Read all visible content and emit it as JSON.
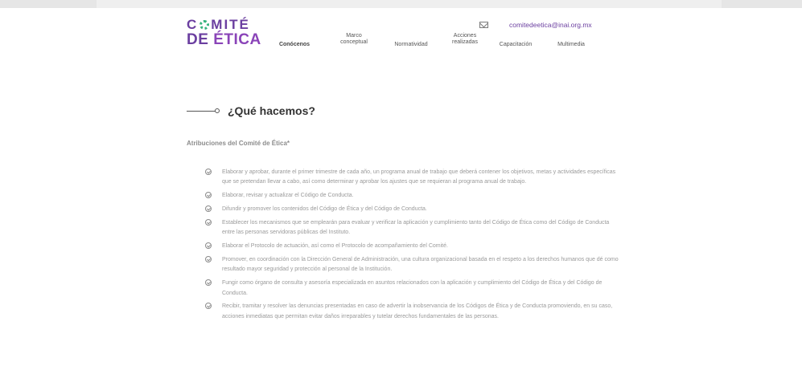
{
  "logo": {
    "line1_a": "C",
    "line1_b": "MITÉ",
    "line2_a": "DE ",
    "line2_b": "ÉTICA"
  },
  "nav": [
    {
      "label": "Conócenos"
    },
    {
      "label": "Marco\nconceptual"
    },
    {
      "label": "Normatividad"
    },
    {
      "label": "Acciones\nrealizadas"
    },
    {
      "label": "Capacitación"
    },
    {
      "label": "Multimedia"
    }
  ],
  "contact": {
    "email": "comitedeetica@inai.org.mx"
  },
  "page": {
    "title": "¿Qué hacemos?",
    "subtitle": "Atribuciones del Comité de Ética*"
  },
  "attributions": [
    "Elaborar y aprobar, durante el primer trimestre de cada año, un programa anual de trabajo que deberá contener los objetivos, metas y actividades específicas que se pretendan llevar a cabo, así como determinar y aprobar los ajustes que se requieran al programa anual de trabajo.",
    "Elaborar, revisar y actualizar el Código de Conducta.",
    "Difundir y promover los contenidos del Código de Ética y del Código de Conducta.",
    "Establecer los mecanismos que se emplearán para evaluar y verificar la aplicación y cumplimiento tanto del Código de Ética como del Código de Conducta entre las personas servidoras públicas del Instituto.",
    "Elaborar el Protocolo de actuación, así como el Protocolo de acompañamiento del Comité.",
    "Promover, en coordinación con la Dirección General de Administración, una cultura organizacional basada en el respeto a los derechos humanos que dé como resultado mayor seguridad y protección al personal de la Institución.",
    "Fungir como órgano de consulta y asesoría especializada en asuntos relacionados con la aplicación y cumplimiento del Código de Ética y del Código de Conducta.",
    "Recibir, tramitar y resolver las denuncias presentadas en caso de advertir la inobservancia de los Códigos de Ética y de Conducta promoviendo, en su caso, acciones inmediatas que permitan evitar daños irreparables y tutelar derechos fundamentales de las personas."
  ]
}
